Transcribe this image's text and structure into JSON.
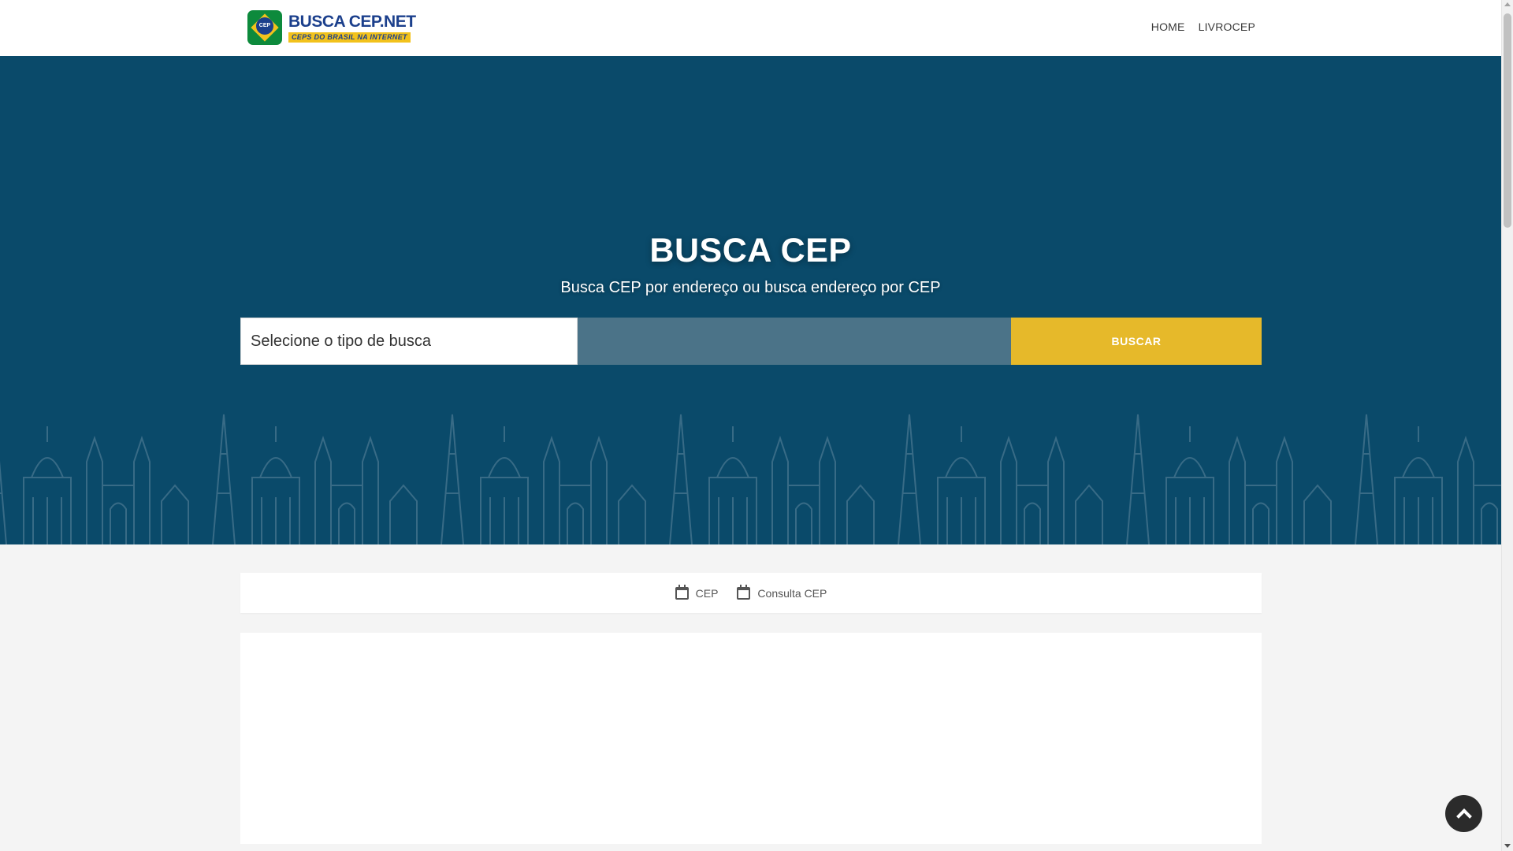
{
  "header": {
    "logo_title": "BUSCA CEP.NET",
    "logo_subtitle": "CEPS DO BRASIL NA INTERNET",
    "logo_badge": "CEP",
    "nav": [
      {
        "label": "HOME"
      },
      {
        "label": "LIVROCEP"
      }
    ]
  },
  "hero": {
    "title": "BUSCA CEP",
    "subtitle": "Busca CEP por endereço ou busca endereço por CEP",
    "search": {
      "select_value": "Selecione o tipo de busca",
      "query_value": "",
      "button_label": "BUSCAR"
    }
  },
  "breadcrumb": [
    {
      "icon": "calendar-icon",
      "label": "CEP"
    },
    {
      "icon": "calendar-icon",
      "label": "Consulta CEP"
    }
  ],
  "colors": {
    "hero_bg": "#0a4a6a",
    "button": "#e6b92a",
    "query_field": "#4b7388",
    "brand_blue": "#1b3f8c",
    "brand_green": "#0d8a3c",
    "brand_yellow": "#f2c21c"
  }
}
